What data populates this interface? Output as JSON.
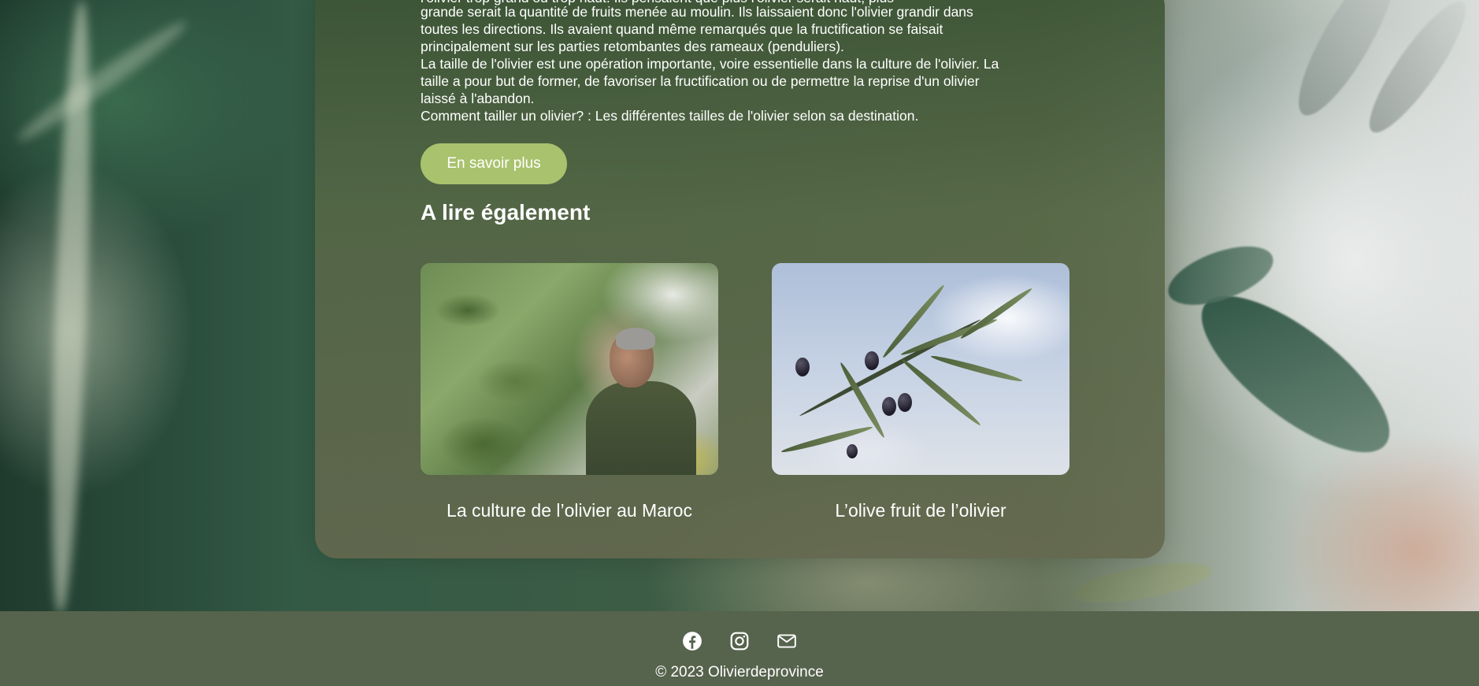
{
  "intro": {
    "cut_line": "l'olivier trop grand ou trop haut. Ils pensaient que plus l'olivier serait haut, plus",
    "lines": [
      "grande serait la quantité de fruits menée au moulin. Ils laissaient donc l'olivier grandir dans",
      "toutes les directions. Ils avaient quand même remarqués que la fructification se faisait",
      "principalement sur les parties retombantes des rameaux (penduliers).",
      "La taille de l'olivier est une opération importante, voire essentielle dans la culture de l'olivier. La",
      "taille a pour but de former, de favoriser la fructification ou de permettre la reprise d'un olivier",
      "laissé à l'abandon.",
      "Comment tailler un olivier? : Les différentes tailles de l'olivier selon sa destination."
    ]
  },
  "cta": {
    "label": "En savoir plus"
  },
  "related": {
    "title": "A lire également",
    "articles": [
      {
        "caption": "La culture de l’olivier au Maroc",
        "image": "olive-farmer-photo"
      },
      {
        "caption": "L’olive fruit de l’olivier",
        "image": "olive-branch-photo"
      }
    ]
  },
  "footer": {
    "social": [
      "facebook-icon",
      "instagram-icon",
      "mail-icon"
    ],
    "copyright": "© 2023 Olivierdeprovince"
  },
  "colors": {
    "button": "#a9c26e",
    "footer": "#56634d"
  }
}
